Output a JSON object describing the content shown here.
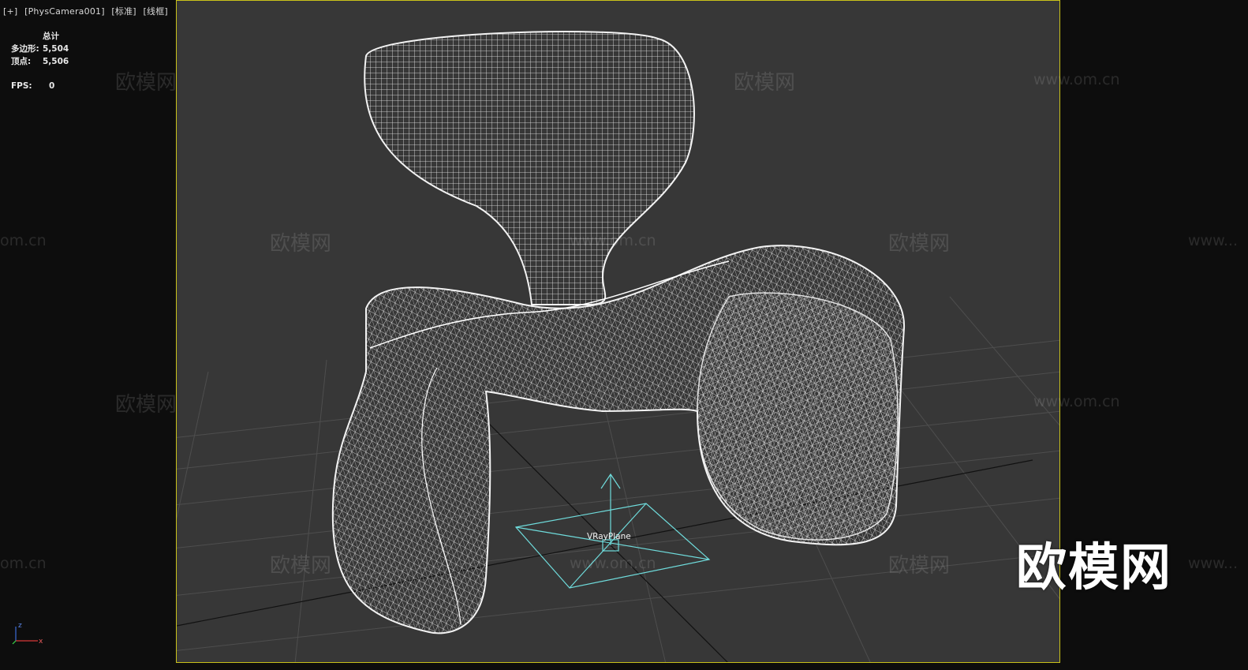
{
  "viewport": {
    "label_parts": [
      "[+]",
      "[PhysCamera001]",
      "[标准]",
      "[线框]"
    ]
  },
  "stats": {
    "header": "总计",
    "rows": [
      {
        "label": "多边形:",
        "value": "5,504"
      },
      {
        "label": "顶点:",
        "value": "5,506"
      }
    ],
    "fps_label": "FPS:",
    "fps_value": "0"
  },
  "scene": {
    "object_label": "VRayPlane"
  },
  "axis_gizmo": {
    "z": "z",
    "x": "x"
  },
  "watermarks": {
    "brand": "欧模网",
    "url": "www.om.cn",
    "url_left": "om.cn",
    "url_right": "www..."
  },
  "colors": {
    "viewport_bg": "#373737",
    "safe_frame": "#c9c21a",
    "wire": "#e6e6e6",
    "helper": "#6fdcdc",
    "grid": "#4c4c4c"
  }
}
